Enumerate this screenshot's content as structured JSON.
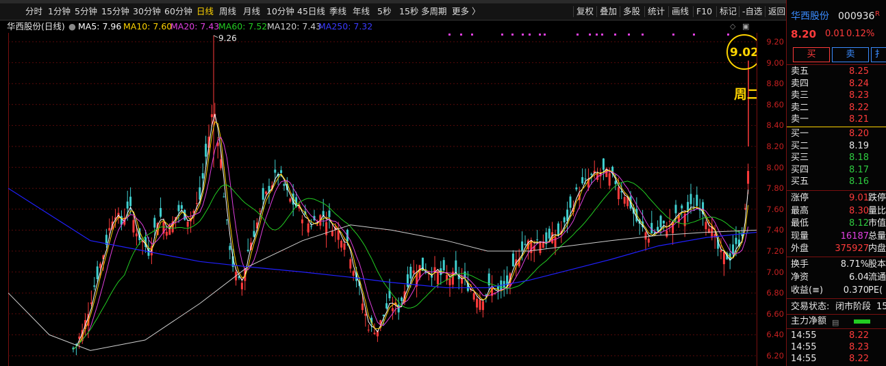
{
  "toolbar": {
    "periods": [
      "分时",
      "1分钟",
      "5分钟",
      "15分钟",
      "30分钟",
      "60分钟",
      "日线",
      "周线",
      "月线",
      "10分钟",
      "45日线",
      "季线",
      "年线",
      "5秒",
      "15秒",
      "多周期",
      "更多 〉"
    ],
    "active_period": "日线",
    "actions": [
      "复权",
      "叠加",
      "多股",
      "统计",
      "画线",
      "F10",
      "标记",
      "-自选",
      "返回"
    ]
  },
  "legend": {
    "title": "华西股份(日线)",
    "ma5": "MA5: 7.96",
    "ma10": "MA10: 7.60",
    "ma20": "MA20: 7.43",
    "ma60": "MA60: 7.52",
    "ma120": "MA120: 7.43",
    "ma250": "MA250: 7.32"
  },
  "colors": {
    "ma5": "#ffffff",
    "ma10": "#ffd400",
    "ma20": "#e040e0",
    "ma60": "#22cc22",
    "ma120": "#d0d0d0",
    "ma250": "#2020ff",
    "up": "#ff3b3b",
    "down": "#40d0d0",
    "highlight": "#ffd400"
  },
  "annotations": {
    "high_label": "9.26",
    "circle_label": "9.02",
    "day_label": "周二"
  },
  "axis": {
    "ticks": [
      "9.20",
      "9.00",
      "8.80",
      "8.60",
      "8.40",
      "8.20",
      "8.00",
      "7.80",
      "7.60",
      "7.40",
      "7.20",
      "7.00",
      "6.80",
      "6.60",
      "6.40",
      "6.20"
    ]
  },
  "panel": {
    "name": "华西股份",
    "code": "000936",
    "r_badge": "R",
    "price": "8.20",
    "change": "0.01",
    "change_pct": "0.12%",
    "buy_label": "买",
    "sell_label": "卖",
    "third_btn": "扌",
    "asks": [
      {
        "label": "卖五",
        "price": "8.25"
      },
      {
        "label": "卖四",
        "price": "8.24"
      },
      {
        "label": "卖三",
        "price": "8.23"
      },
      {
        "label": "卖二",
        "price": "8.22"
      },
      {
        "label": "卖一",
        "price": "8.21"
      }
    ],
    "bids": [
      {
        "label": "买一",
        "price": "8.20"
      },
      {
        "label": "买二",
        "price": "8.19"
      },
      {
        "label": "买三",
        "price": "8.18"
      },
      {
        "label": "买四",
        "price": "8.17"
      },
      {
        "label": "买五",
        "price": "8.16"
      }
    ],
    "stats": [
      {
        "label": "涨停",
        "value": "9.01",
        "extra": "跌停"
      },
      {
        "label": "最高",
        "value": "8.30",
        "extra": "量比"
      },
      {
        "label": "最低",
        "value": "8.12",
        "extra": "市值"
      },
      {
        "label": "现量",
        "value": "16187",
        "extra": "总量"
      },
      {
        "label": "外盘",
        "value": "375927",
        "extra": "内盘"
      }
    ],
    "stats2": [
      {
        "label": "换手",
        "value": "8.71%",
        "extra": "股本"
      },
      {
        "label": "净资",
        "value": "6.04",
        "extra": "流通"
      },
      {
        "label": "收益(≡)",
        "value": "0.370",
        "extra": "PE("
      }
    ],
    "status_label": "交易状态:",
    "status_value": "闭市阶段",
    "status_extra": "15",
    "main_flow_label": "主力净额",
    "ticks": [
      {
        "time": "14:55",
        "price": "8.22"
      },
      {
        "time": "14:55",
        "price": "8.23"
      },
      {
        "time": "14:55",
        "price": "8.22"
      }
    ]
  }
}
